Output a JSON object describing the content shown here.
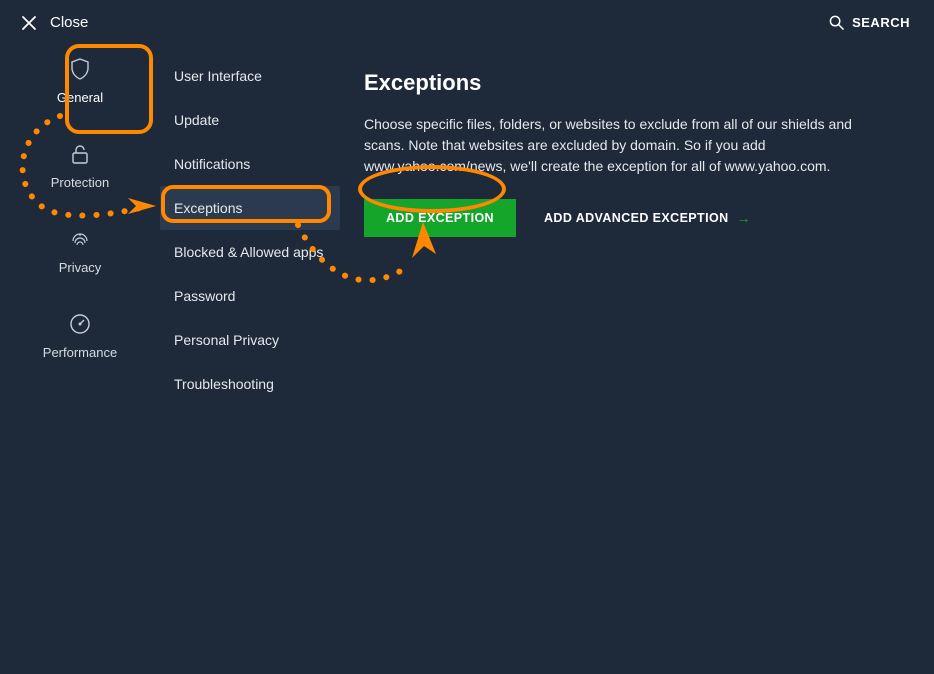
{
  "topbar": {
    "close_label": "Close",
    "search_label": "SEARCH"
  },
  "categories": [
    {
      "key": "general",
      "label": "General",
      "icon": "shield-icon"
    },
    {
      "key": "protection",
      "label": "Protection",
      "icon": "lock-icon"
    },
    {
      "key": "privacy",
      "label": "Privacy",
      "icon": "fingerprint-icon"
    },
    {
      "key": "performance",
      "label": "Performance",
      "icon": "gauge-icon"
    }
  ],
  "menu": {
    "items": [
      "User Interface",
      "Update",
      "Notifications",
      "Exceptions",
      "Blocked & Allowed apps",
      "Password",
      "Personal Privacy",
      "Troubleshooting"
    ],
    "selected_index": 3
  },
  "content": {
    "title": "Exceptions",
    "description": "Choose specific files, folders, or websites to exclude from all of our shields and scans. Note that websites are excluded by domain. So if you add www.yahoo.com/news, we'll create the exception for all of www.yahoo.com.",
    "primary_button": "ADD EXCEPTION",
    "secondary_button": "ADD ADVANCED EXCEPTION"
  },
  "colors": {
    "accent_green": "#15a52b",
    "annotation_orange": "#ff8800",
    "bg": "#1e2a3a"
  }
}
